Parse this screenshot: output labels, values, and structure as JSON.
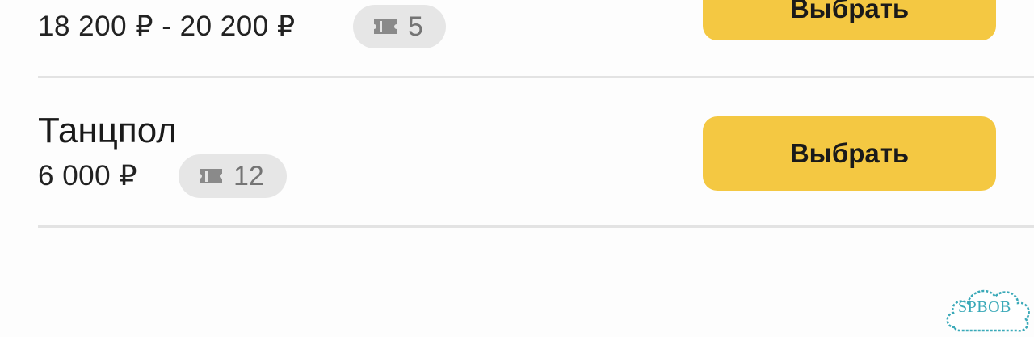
{
  "tickets": [
    {
      "title": "",
      "price": "18 200 ₽ - 20 200 ₽",
      "available": "5",
      "button_label": "Выбрать"
    },
    {
      "title": "Танцпол",
      "price": "6 000 ₽",
      "available": "12",
      "button_label": "Выбрать"
    }
  ],
  "icons": {
    "ticket": "ticket-icon"
  },
  "colors": {
    "button": "#f4c842",
    "badge": "#e6e6e6",
    "watermark": "#3aa9b8"
  },
  "watermark": {
    "text": "SPBOB"
  }
}
